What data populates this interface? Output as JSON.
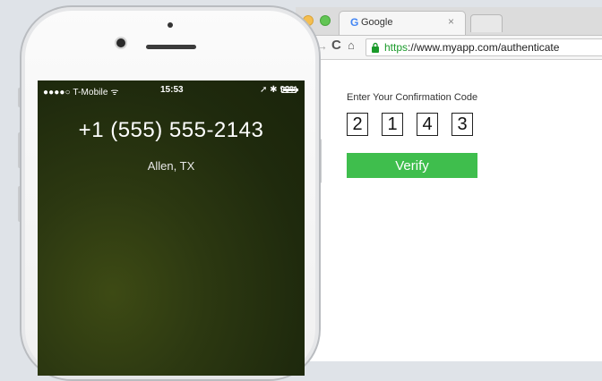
{
  "browser": {
    "tab": {
      "icon": "google-g-icon",
      "favicon_letter": "G",
      "title": "Google",
      "close": "×"
    },
    "nav": {
      "forward": "→",
      "reload": "C",
      "home": "⌂"
    },
    "address": {
      "scheme": "https",
      "rest": "://www.myapp.com/authenticate"
    }
  },
  "page": {
    "code_label": "Enter Your Confirmation Code",
    "code_digits": [
      "2",
      "1",
      "4",
      "3"
    ],
    "verify_label": "Verify",
    "verify_color": "#3fbe4d"
  },
  "phone": {
    "status": {
      "carrier": "●●●●○ T-Mobile ᯤ",
      "time": "15:53",
      "battery": "➚ ✱ 90%"
    },
    "caller": {
      "number": "+1 (555) 555-2143",
      "location": "Allen, TX"
    }
  }
}
